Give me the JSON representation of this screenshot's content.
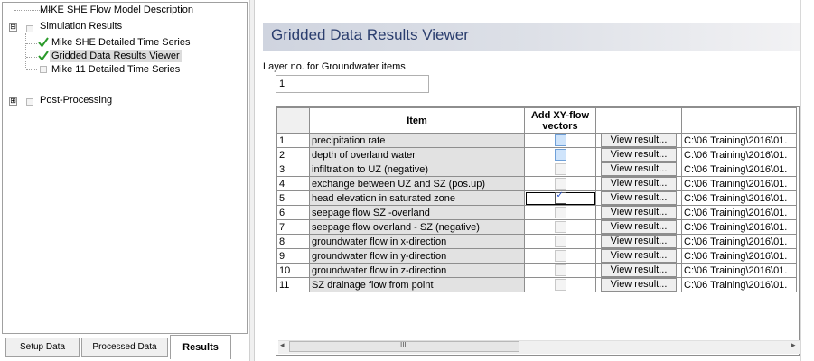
{
  "tree": {
    "items": [
      {
        "label": "MIKE SHE Flow Model Description"
      },
      {
        "label": "Simulation Results",
        "expander": "⊟"
      },
      {
        "label": "Mike SHE Detailed Time Series"
      },
      {
        "label": "Gridded Data Results Viewer"
      },
      {
        "label": "Mike 11 Detailed Time Series"
      },
      {
        "label": "Post-Processing",
        "expander": "⊞"
      }
    ]
  },
  "tabs": [
    {
      "label": "Setup Data"
    },
    {
      "label": "Processed Data"
    },
    {
      "label": "Results"
    }
  ],
  "viewer": {
    "title": "Gridded Data Results Viewer",
    "layer_label": "Layer no. for Groundwater items",
    "layer_value": "1"
  },
  "grid": {
    "headers": {
      "num": "",
      "item": "Item",
      "vectors_line1": "Add XY-flow",
      "vectors_line2": "vectors",
      "button": "",
      "path": ""
    },
    "button_label": "View result...",
    "rows": [
      {
        "num": "1",
        "item": "precipitation rate",
        "path": "C:\\06 Training\\2016\\01."
      },
      {
        "num": "2",
        "item": "depth of overland water",
        "path": "C:\\06 Training\\2016\\01."
      },
      {
        "num": "3",
        "item": "infiltration to UZ (negative)",
        "path": "C:\\06 Training\\2016\\01."
      },
      {
        "num": "4",
        "item": "exchange between UZ and SZ (pos.up)",
        "path": "C:\\06 Training\\2016\\01."
      },
      {
        "num": "5",
        "item": "head elevation in saturated zone",
        "path": "C:\\06 Training\\2016\\01."
      },
      {
        "num": "6",
        "item": "seepage flow SZ -overland",
        "path": "C:\\06 Training\\2016\\01."
      },
      {
        "num": "7",
        "item": "seepage flow overland - SZ (negative)",
        "path": "C:\\06 Training\\2016\\01."
      },
      {
        "num": "8",
        "item": "groundwater flow in x-direction",
        "path": "C:\\06 Training\\2016\\01."
      },
      {
        "num": "9",
        "item": "groundwater flow in y-direction",
        "path": "C:\\06 Training\\2016\\01."
      },
      {
        "num": "10",
        "item": "groundwater flow in z-direction",
        "path": "C:\\06 Training\\2016\\01."
      },
      {
        "num": "11",
        "item": "SZ drainage flow from point",
        "path": "C:\\06 Training\\2016\\01."
      }
    ]
  },
  "scrollbar": {
    "left_arrow": "◂",
    "right_arrow": "▸",
    "grip": "III"
  },
  "colors": {
    "title": "#2b3e6e",
    "check_blue": "#2a55c9"
  }
}
